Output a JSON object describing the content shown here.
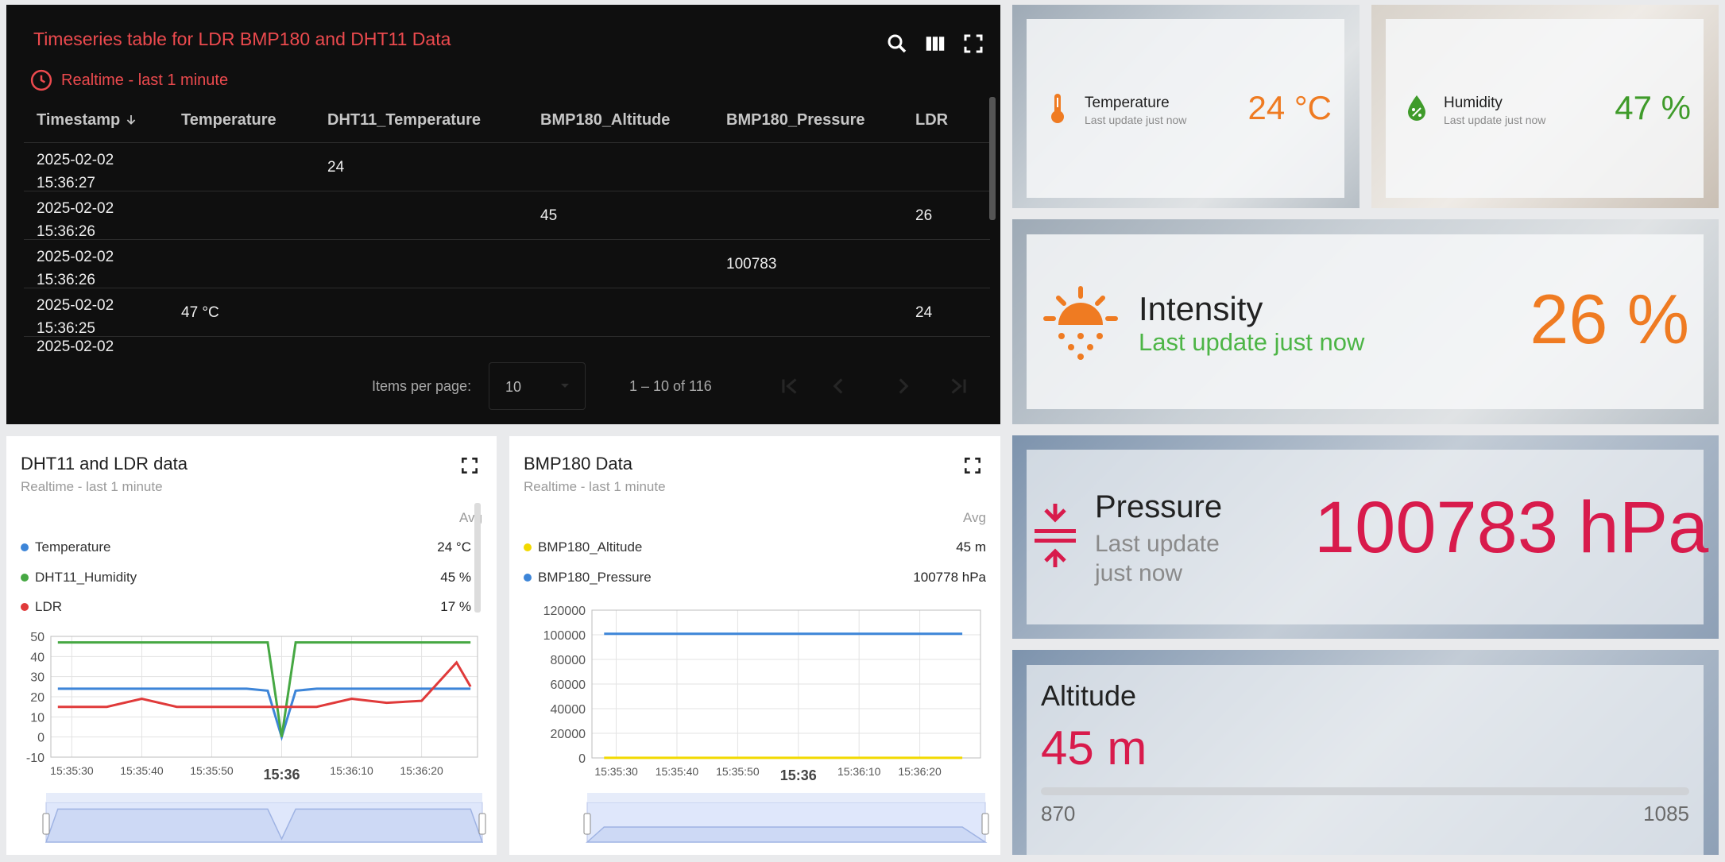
{
  "table": {
    "title": "Timeseries table for LDR BMP180 and DHT11 Data",
    "subtitle": "Realtime - last 1 minute",
    "columns": [
      "Timestamp",
      "Temperature",
      "DHT11_Temperature",
      "BMP180_Altitude",
      "BMP180_Pressure",
      "LDR"
    ],
    "rows": [
      {
        "ts_date": "2025-02-02",
        "ts_time": "15:36:27",
        "temperature": "",
        "dht11_temperature": "24",
        "bmp180_altitude": "",
        "bmp180_pressure": "",
        "ldr": ""
      },
      {
        "ts_date": "2025-02-02",
        "ts_time": "15:36:26",
        "temperature": "",
        "dht11_temperature": "",
        "bmp180_altitude": "45",
        "bmp180_pressure": "",
        "ldr": "26"
      },
      {
        "ts_date": "2025-02-02",
        "ts_time": "15:36:26",
        "temperature": "",
        "dht11_temperature": "",
        "bmp180_altitude": "",
        "bmp180_pressure": "100783",
        "ldr": ""
      },
      {
        "ts_date": "2025-02-02",
        "ts_time": "15:36:25",
        "temperature": "47 °C",
        "dht11_temperature": "",
        "bmp180_altitude": "",
        "bmp180_pressure": "",
        "ldr": "24"
      },
      {
        "ts_date": "2025-02-02",
        "ts_time": "",
        "temperature": "",
        "dht11_temperature": "",
        "bmp180_altitude": "",
        "bmp180_pressure": "",
        "ldr": ""
      }
    ],
    "pager": {
      "label": "Items per page:",
      "page_size": "10",
      "range": "1 – 10 of 116"
    },
    "icons": [
      "search-icon",
      "columns-icon",
      "fullscreen-icon",
      "clock-icon",
      "sort-arrow-down-icon",
      "first-page-icon",
      "prev-page-icon",
      "next-page-icon",
      "last-page-icon"
    ]
  },
  "temperature_card": {
    "title": "Temperature",
    "subtitle": "Last update just now",
    "value": "24 °C",
    "color": "#ef7b22"
  },
  "humidity_card": {
    "title": "Humidity",
    "subtitle": "Last update just now",
    "value": "47 %",
    "color": "#3f9b2a"
  },
  "intensity_card": {
    "title": "Intensity",
    "subtitle": "Last update just now",
    "value": "26 %",
    "accent": "#ef7b22",
    "subtitle_color": "#4db546"
  },
  "pressure_card": {
    "title": "Pressure",
    "subtitle_line1": "Last update",
    "subtitle_line2": "just now",
    "value": "100783 hPa",
    "color": "#d81b4c"
  },
  "altitude_card": {
    "title": "Altitude",
    "value": "45 m",
    "progress_fraction": 0,
    "range_min": "870",
    "range_max": "1085",
    "color": "#d81b4c"
  },
  "dht_chart": {
    "title": "DHT11 and LDR data",
    "subtitle": "Realtime - last 1 minute",
    "avg_label": "Avg",
    "legend": [
      {
        "name": "Temperature",
        "avg": "24 °C",
        "color": "#3d85d8"
      },
      {
        "name": "DHT11_Humidity",
        "avg": "45 %",
        "color": "#46a843"
      },
      {
        "name": "LDR",
        "avg": "17 %",
        "color": "#e03a3a"
      }
    ],
    "x_ticks": [
      "15:35:30",
      "15:35:40",
      "15:35:50",
      "15:36",
      "15:36:10",
      "15:36:20"
    ],
    "y_ticks": [
      "50",
      "40",
      "30",
      "20",
      "10",
      "0",
      "-10"
    ]
  },
  "bmp_chart": {
    "title": "BMP180 Data",
    "subtitle": "Realtime - last 1 minute",
    "avg_label": "Avg",
    "legend": [
      {
        "name": "BMP180_Altitude",
        "avg": "45 m",
        "color": "#f2d900"
      },
      {
        "name": "BMP180_Pressure",
        "avg": "100778 hPa",
        "color": "#3d85d8"
      }
    ],
    "x_ticks": [
      "15:35:30",
      "15:35:40",
      "15:35:50",
      "15:36",
      "15:36:10",
      "15:36:20"
    ],
    "y_ticks": [
      "120000",
      "100000",
      "80000",
      "60000",
      "40000",
      "20000",
      "0"
    ]
  },
  "chart_data": [
    {
      "type": "line",
      "title": "DHT11 and LDR data",
      "x": [
        "15:35:28",
        "15:35:30",
        "15:35:35",
        "15:35:40",
        "15:35:45",
        "15:35:50",
        "15:35:55",
        "15:35:58",
        "15:36:00",
        "15:36:02",
        "15:36:05",
        "15:36:10",
        "15:36:15",
        "15:36:20",
        "15:36:25",
        "15:36:27"
      ],
      "ylim": [
        -10,
        50
      ],
      "series": [
        {
          "name": "Temperature",
          "values": [
            24,
            24,
            24,
            24,
            24,
            24,
            24,
            23,
            0,
            23,
            24,
            24,
            24,
            24,
            24,
            24
          ]
        },
        {
          "name": "DHT11_Humidity",
          "values": [
            47,
            47,
            47,
            47,
            47,
            47,
            47,
            47,
            0,
            47,
            47,
            47,
            47,
            47,
            47,
            47
          ]
        },
        {
          "name": "LDR",
          "values": [
            15,
            15,
            15,
            19,
            15,
            15,
            15,
            15,
            15,
            15,
            15,
            19,
            17,
            18,
            37,
            25
          ]
        }
      ]
    },
    {
      "type": "line",
      "title": "BMP180 Data",
      "x": [
        "15:35:28",
        "15:36:27"
      ],
      "ylim": [
        0,
        120000
      ],
      "series": [
        {
          "name": "BMP180_Altitude",
          "values": [
            45,
            45
          ]
        },
        {
          "name": "BMP180_Pressure",
          "values": [
            100778,
            100778
          ]
        }
      ]
    }
  ]
}
